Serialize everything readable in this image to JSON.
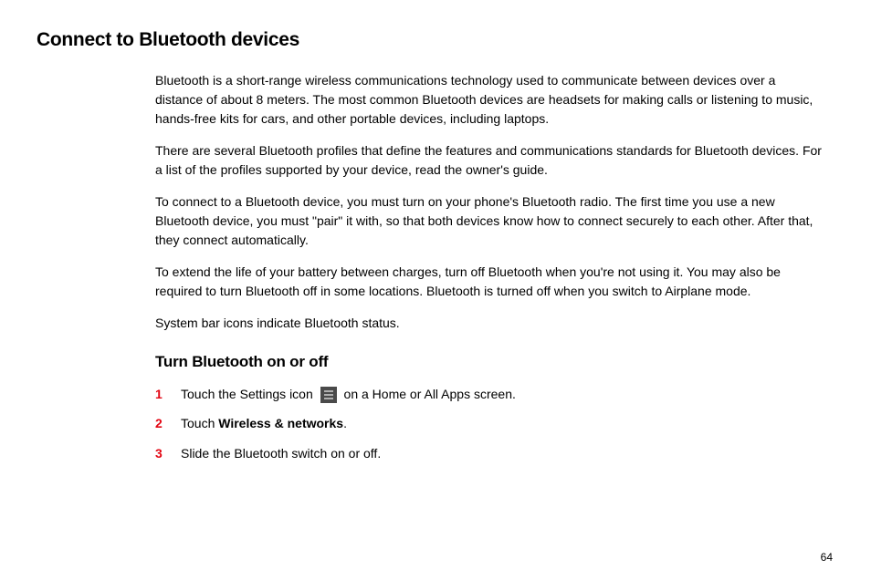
{
  "page": {
    "title": "Connect to Bluetooth devices",
    "section_heading": "Turn Bluetooth on or off",
    "page_number": "64"
  },
  "paragraphs": {
    "p1": "Bluetooth is a short-range wireless communications technology used to communicate between devices over a distance of about 8 meters. The most common Bluetooth devices are headsets for making calls or listening to music, hands-free kits for cars, and other portable devices, including laptops.",
    "p2": "There are several Bluetooth profiles that define the features and communications standards for Bluetooth devices. For a list of the profiles supported by your device, read the owner's guide.",
    "p3": "To connect to a Bluetooth device, you must turn on your phone's Bluetooth radio. The first time you use a new Bluetooth device, you must \"pair\" it with, so that both devices know how to connect securely to each other. After that, they connect automatically.",
    "p4": "To extend the life of your battery between charges, turn off Bluetooth when you're not using it. You may also be required to turn Bluetooth off in some locations. Bluetooth is turned off when you switch to Airplane mode.",
    "p5": "System bar icons indicate Bluetooth status."
  },
  "steps": {
    "s1": {
      "num": "1",
      "text_before": "Touch the Settings icon ",
      "text_after": " on a Home or All Apps screen."
    },
    "s2": {
      "num": "2",
      "text_before": "Touch ",
      "bold": "Wireless & networks",
      "text_after": "."
    },
    "s3": {
      "num": "3",
      "text": "Slide the Bluetooth switch on or off."
    }
  }
}
